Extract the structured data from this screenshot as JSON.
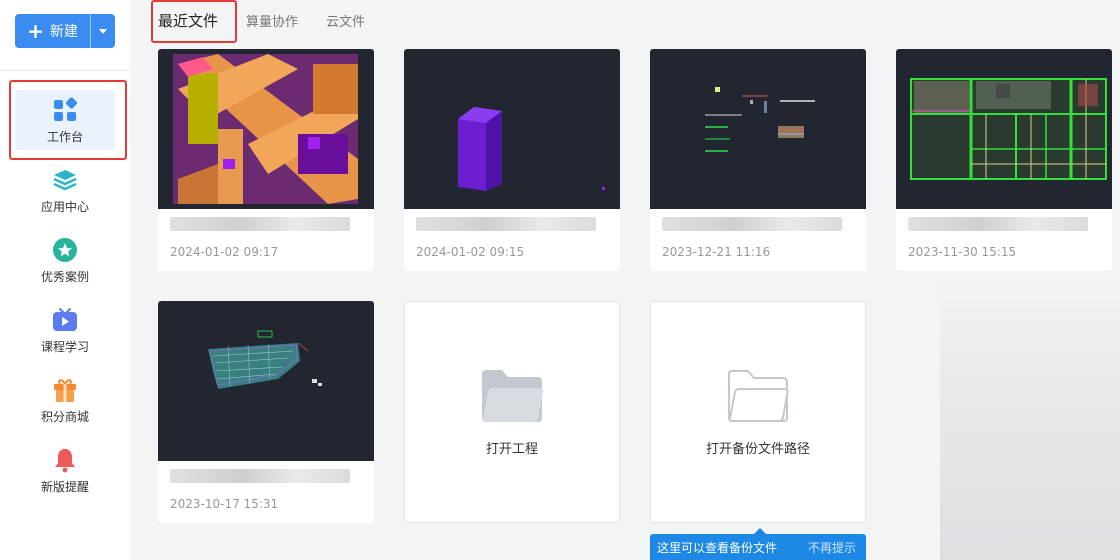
{
  "sidebar": {
    "new_button": {
      "label": "新建"
    },
    "items": [
      {
        "label": "工作台",
        "icon": "grid-diamond-icon",
        "active": true
      },
      {
        "label": "应用中心",
        "icon": "layers-icon"
      },
      {
        "label": "优秀案例",
        "icon": "star-badge-icon"
      },
      {
        "label": "课程学习",
        "icon": "video-tv-icon"
      },
      {
        "label": "积分商城",
        "icon": "gift-icon"
      },
      {
        "label": "新版提醒",
        "icon": "bell-icon"
      }
    ]
  },
  "tabs": [
    {
      "label": "最近文件",
      "active": true
    },
    {
      "label": "算量协作"
    },
    {
      "label": "云文件"
    }
  ],
  "files": [
    {
      "date": "2024-01-02 09:17"
    },
    {
      "date": "2024-01-02 09:15"
    },
    {
      "date": "2023-12-21 11:16"
    },
    {
      "date": "2023-11-30 15:15"
    },
    {
      "date": "2023-10-17 15:31"
    }
  ],
  "actions": {
    "open_project": "打开工程",
    "open_backup_path": "打开备份文件路径"
  },
  "tooltip": {
    "text": "这里可以查看备份文件",
    "dismiss": "不再提示"
  },
  "colors": {
    "primary": "#3a8cf0",
    "highlight_red": "#e53935",
    "tooltip_bg": "#1e88e5",
    "thumb_bg": "#212630"
  }
}
